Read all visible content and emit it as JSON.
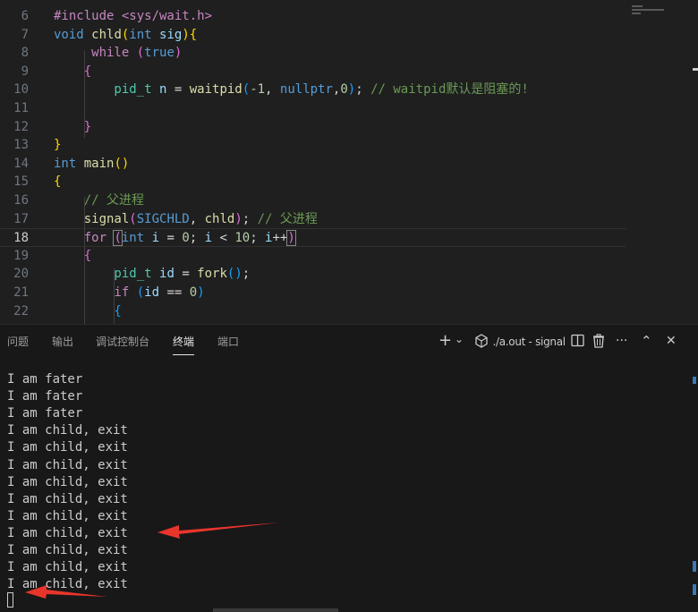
{
  "editor": {
    "top_partial_text": "#include <sys/wait.h>",
    "lines": [
      {
        "num": "6",
        "segments": []
      },
      {
        "num": "7",
        "segments": [
          {
            "t": "void ",
            "c": "#569cd6"
          },
          {
            "t": "chld",
            "c": "#dcdcaa"
          },
          {
            "t": "(",
            "c": "#ffd700"
          },
          {
            "t": "int ",
            "c": "#569cd6"
          },
          {
            "t": "sig",
            "c": "#9cdcfe"
          },
          {
            "t": ")",
            "c": "#ffd700"
          },
          {
            "t": "{",
            "c": "#ffd700"
          }
        ]
      },
      {
        "num": "8",
        "segments": [
          {
            "t": "     while ",
            "c": "#c586c0"
          },
          {
            "t": "(",
            "c": "#da70d6"
          },
          {
            "t": "true",
            "c": "#569cd6"
          },
          {
            "t": ")",
            "c": "#da70d6"
          }
        ]
      },
      {
        "num": "9",
        "segments": [
          {
            "t": "    {",
            "c": "#da70d6"
          }
        ]
      },
      {
        "num": "10",
        "segments": [
          {
            "t": "        pid_t ",
            "c": "#4ec9b0"
          },
          {
            "t": "n ",
            "c": "#9cdcfe"
          },
          {
            "t": "= ",
            "c": "#d4d4d4"
          },
          {
            "t": "waitpid",
            "c": "#dcdcaa"
          },
          {
            "t": "(",
            "c": "#179fff"
          },
          {
            "t": "-1",
            "c": "#b5cea8"
          },
          {
            "t": ", ",
            "c": "#d4d4d4"
          },
          {
            "t": "nullptr",
            "c": "#569cd6"
          },
          {
            "t": ",",
            "c": "#d4d4d4"
          },
          {
            "t": "0",
            "c": "#b5cea8"
          },
          {
            "t": ")",
            "c": "#179fff"
          },
          {
            "t": "; ",
            "c": "#d4d4d4"
          },
          {
            "t": "// waitpid默认是阻塞的!",
            "c": "#6a9955"
          }
        ]
      },
      {
        "num": "11",
        "segments": []
      },
      {
        "num": "12",
        "segments": [
          {
            "t": "    }",
            "c": "#da70d6"
          }
        ]
      },
      {
        "num": "13",
        "segments": [
          {
            "t": "}",
            "c": "#ffd700"
          }
        ]
      },
      {
        "num": "14",
        "segments": [
          {
            "t": "int ",
            "c": "#569cd6"
          },
          {
            "t": "main",
            "c": "#dcdcaa"
          },
          {
            "t": "()",
            "c": "#ffd700"
          }
        ]
      },
      {
        "num": "15",
        "segments": [
          {
            "t": "{",
            "c": "#ffd700"
          }
        ]
      },
      {
        "num": "16",
        "segments": [
          {
            "t": "    // 父进程",
            "c": "#6a9955"
          }
        ]
      },
      {
        "num": "17",
        "segments": [
          {
            "t": "    signal",
            "c": "#dcdcaa"
          },
          {
            "t": "(",
            "c": "#da70d6"
          },
          {
            "t": "SIGCHLD",
            "c": "#569cd6"
          },
          {
            "t": ", ",
            "c": "#d4d4d4"
          },
          {
            "t": "chld",
            "c": "#dcdcaa"
          },
          {
            "t": ")",
            "c": "#da70d6"
          },
          {
            "t": "; ",
            "c": "#d4d4d4"
          },
          {
            "t": "// 父进程",
            "c": "#6a9955"
          }
        ]
      },
      {
        "num": "18",
        "current": true,
        "segments": [
          {
            "t": "    for ",
            "c": "#c586c0"
          },
          {
            "t": "(",
            "c": "#da70d6"
          },
          {
            "t": "int ",
            "c": "#569cd6"
          },
          {
            "t": "i ",
            "c": "#9cdcfe"
          },
          {
            "t": "= ",
            "c": "#d4d4d4"
          },
          {
            "t": "0",
            "c": "#b5cea8"
          },
          {
            "t": "; ",
            "c": "#d4d4d4"
          },
          {
            "t": "i ",
            "c": "#9cdcfe"
          },
          {
            "t": "< ",
            "c": "#d4d4d4"
          },
          {
            "t": "10",
            "c": "#b5cea8"
          },
          {
            "t": "; ",
            "c": "#d4d4d4"
          },
          {
            "t": "i",
            "c": "#9cdcfe"
          },
          {
            "t": "++",
            "c": "#d4d4d4"
          },
          {
            "t": ")",
            "c": "#da70d6"
          }
        ]
      },
      {
        "num": "19",
        "segments": [
          {
            "t": "    {",
            "c": "#da70d6"
          }
        ]
      },
      {
        "num": "20",
        "segments": [
          {
            "t": "        pid_t ",
            "c": "#4ec9b0"
          },
          {
            "t": "id ",
            "c": "#9cdcfe"
          },
          {
            "t": "= ",
            "c": "#d4d4d4"
          },
          {
            "t": "fork",
            "c": "#dcdcaa"
          },
          {
            "t": "()",
            "c": "#179fff"
          },
          {
            "t": ";",
            "c": "#d4d4d4"
          }
        ]
      },
      {
        "num": "21",
        "segments": [
          {
            "t": "        if ",
            "c": "#c586c0"
          },
          {
            "t": "(",
            "c": "#179fff"
          },
          {
            "t": "id ",
            "c": "#9cdcfe"
          },
          {
            "t": "== ",
            "c": "#d4d4d4"
          },
          {
            "t": "0",
            "c": "#b5cea8"
          },
          {
            "t": ")",
            "c": "#179fff"
          }
        ]
      },
      {
        "num": "22",
        "segments": [
          {
            "t": "        {",
            "c": "#179fff"
          }
        ]
      }
    ]
  },
  "panel": {
    "tabs": [
      {
        "label": "问题",
        "active": false
      },
      {
        "label": "输出",
        "active": false
      },
      {
        "label": "调试控制台",
        "active": false
      },
      {
        "label": "终端",
        "active": true
      },
      {
        "label": "端口",
        "active": false
      }
    ],
    "actions": {
      "add": "+",
      "add_dropdown": "⌄",
      "terminal_name": "./a.out - signal",
      "more": "···",
      "maximize": "⌃",
      "close": "✕"
    }
  },
  "terminal": {
    "lines": [
      "I am fater",
      "I am fater",
      "I am fater",
      "I am child, exit",
      "I am child, exit",
      "I am child, exit",
      "I am child, exit",
      "I am child, exit",
      "I am child, exit",
      "I am child, exit",
      "I am child, exit",
      "I am child, exit",
      "I am child, exit"
    ]
  },
  "colors": {
    "annotation_arrow": "#e8352c",
    "editor_bg": "#1f1f1f",
    "panel_bg": "#181818"
  }
}
